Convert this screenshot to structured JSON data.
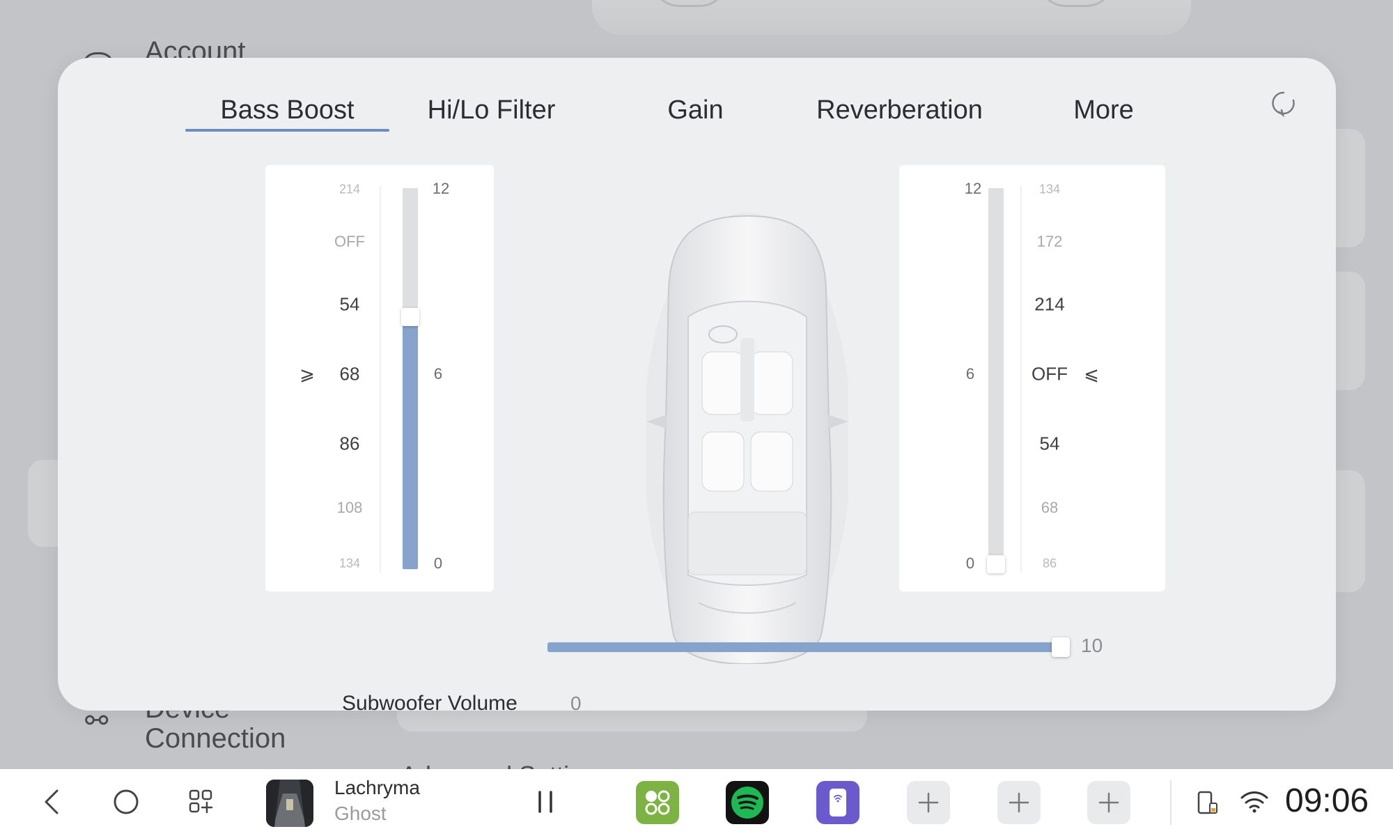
{
  "background": {
    "account_label": "Account",
    "device_label_line1": "Device",
    "device_label_line2": "Connection",
    "advanced_label": "Advanced Setti"
  },
  "tabs": [
    {
      "label": "Bass Boost",
      "selected": true
    },
    {
      "label": "Hi/Lo Filter",
      "selected": false
    },
    {
      "label": "Gain",
      "selected": false
    },
    {
      "label": "Reverberation",
      "selected": false
    },
    {
      "label": "More",
      "selected": false
    }
  ],
  "left_panel": {
    "scale": [
      "214",
      "OFF",
      "54",
      "68",
      "86",
      "108",
      "134"
    ],
    "selected": "68",
    "arrow": "⩾",
    "slider": {
      "max": "12",
      "mid": "6",
      "min": "0",
      "value": 8
    }
  },
  "right_panel": {
    "scale": [
      "134",
      "172",
      "214",
      "OFF",
      "54",
      "68",
      "86"
    ],
    "selected": "OFF",
    "arrow": "⩽",
    "slider": {
      "max": "12",
      "mid": "6",
      "min": "0",
      "value": 0
    }
  },
  "subwoofer": {
    "label": "Subwoofer Volume",
    "min": "0",
    "max": "10",
    "value": 10
  },
  "dock": {
    "now_playing": {
      "title": "Lachryma",
      "artist": "Ghost"
    },
    "time": "09:06",
    "icons": [
      "back-icon",
      "home-icon",
      "apps-icon",
      "pause-icon",
      "phone-battery-icon",
      "wifi-icon"
    ],
    "apps": [
      "green-app",
      "spotify",
      "purple-app",
      "add",
      "add",
      "add"
    ],
    "colors": {
      "green": "#7cb342",
      "spotify": "#1db954",
      "purple": "#6a5acd",
      "accent": "#86a3cc"
    }
  }
}
